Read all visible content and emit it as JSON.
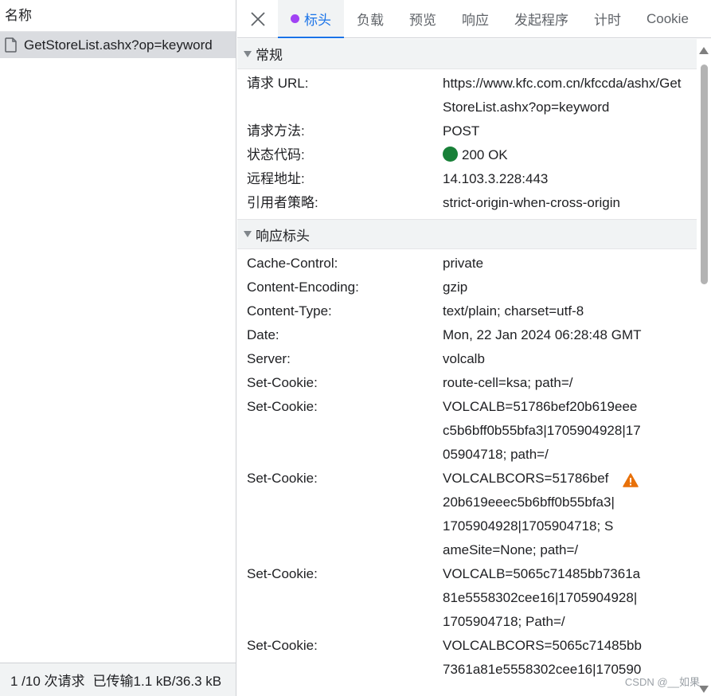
{
  "left": {
    "header": "名称",
    "request_name": "GetStoreList.ashx?op=keyword",
    "footer_count": "1 /10 次请求",
    "footer_transfer": "已传输1.1 kB/36.3 kB"
  },
  "tabs": [
    {
      "label": "标头",
      "active": true
    },
    {
      "label": "负载"
    },
    {
      "label": "预览"
    },
    {
      "label": "响应"
    },
    {
      "label": "发起程序"
    },
    {
      "label": "计时"
    },
    {
      "label": "Cookie"
    }
  ],
  "general": {
    "title": "常规",
    "rows": [
      {
        "key": "请求 URL:",
        "value": "https://www.kfc.com.cn/kfccda/ashx/GetStoreList.ashx?op=keyword"
      },
      {
        "key": "请求方法:",
        "value": "POST"
      },
      {
        "key": "状态代码:",
        "value": "200 OK"
      },
      {
        "key": "远程地址:",
        "value": "14.103.3.228:443"
      },
      {
        "key": "引用者策略:",
        "value": "strict-origin-when-cross-origin"
      }
    ]
  },
  "response_headers": {
    "title": "响应标头",
    "rows": [
      {
        "key": "Cache-Control:",
        "value": "private"
      },
      {
        "key": "Content-Encoding:",
        "value": "gzip"
      },
      {
        "key": "Content-Type:",
        "value": "text/plain; charset=utf-8"
      },
      {
        "key": "Date:",
        "value": "Mon, 22 Jan 2024 06:28:48 GMT"
      },
      {
        "key": "Server:",
        "value": "volcalb"
      },
      {
        "key": "Set-Cookie:",
        "value": "route-cell=ksa; path=/"
      },
      {
        "key": "Set-Cookie:",
        "value": "VOLCALB=51786bef20b619eeec5b6bff0b55bfa3|1705904928|1705904718; path=/"
      },
      {
        "key": "Set-Cookie:",
        "value": "VOLCALBCORS=51786bef20b619eeec5b6bff0b55bfa3|1705904928|1705904718; SameSite=None; path=/"
      },
      {
        "key": "Set-Cookie:",
        "value": "VOLCALB=5065c71485bb7361a81e5558302cee16|1705904928|1705904718; Path=/"
      },
      {
        "key": "Set-Cookie:",
        "value": "VOLCALBCORS=5065c71485bb7361a81e5558302cee16|170590"
      }
    ]
  },
  "watermark": "CSDN @__如果",
  "colors": {
    "accent": "#1a73e8",
    "status_ok": "#188038",
    "warning": "#e8710a",
    "tab_dot": "#a142f4"
  }
}
